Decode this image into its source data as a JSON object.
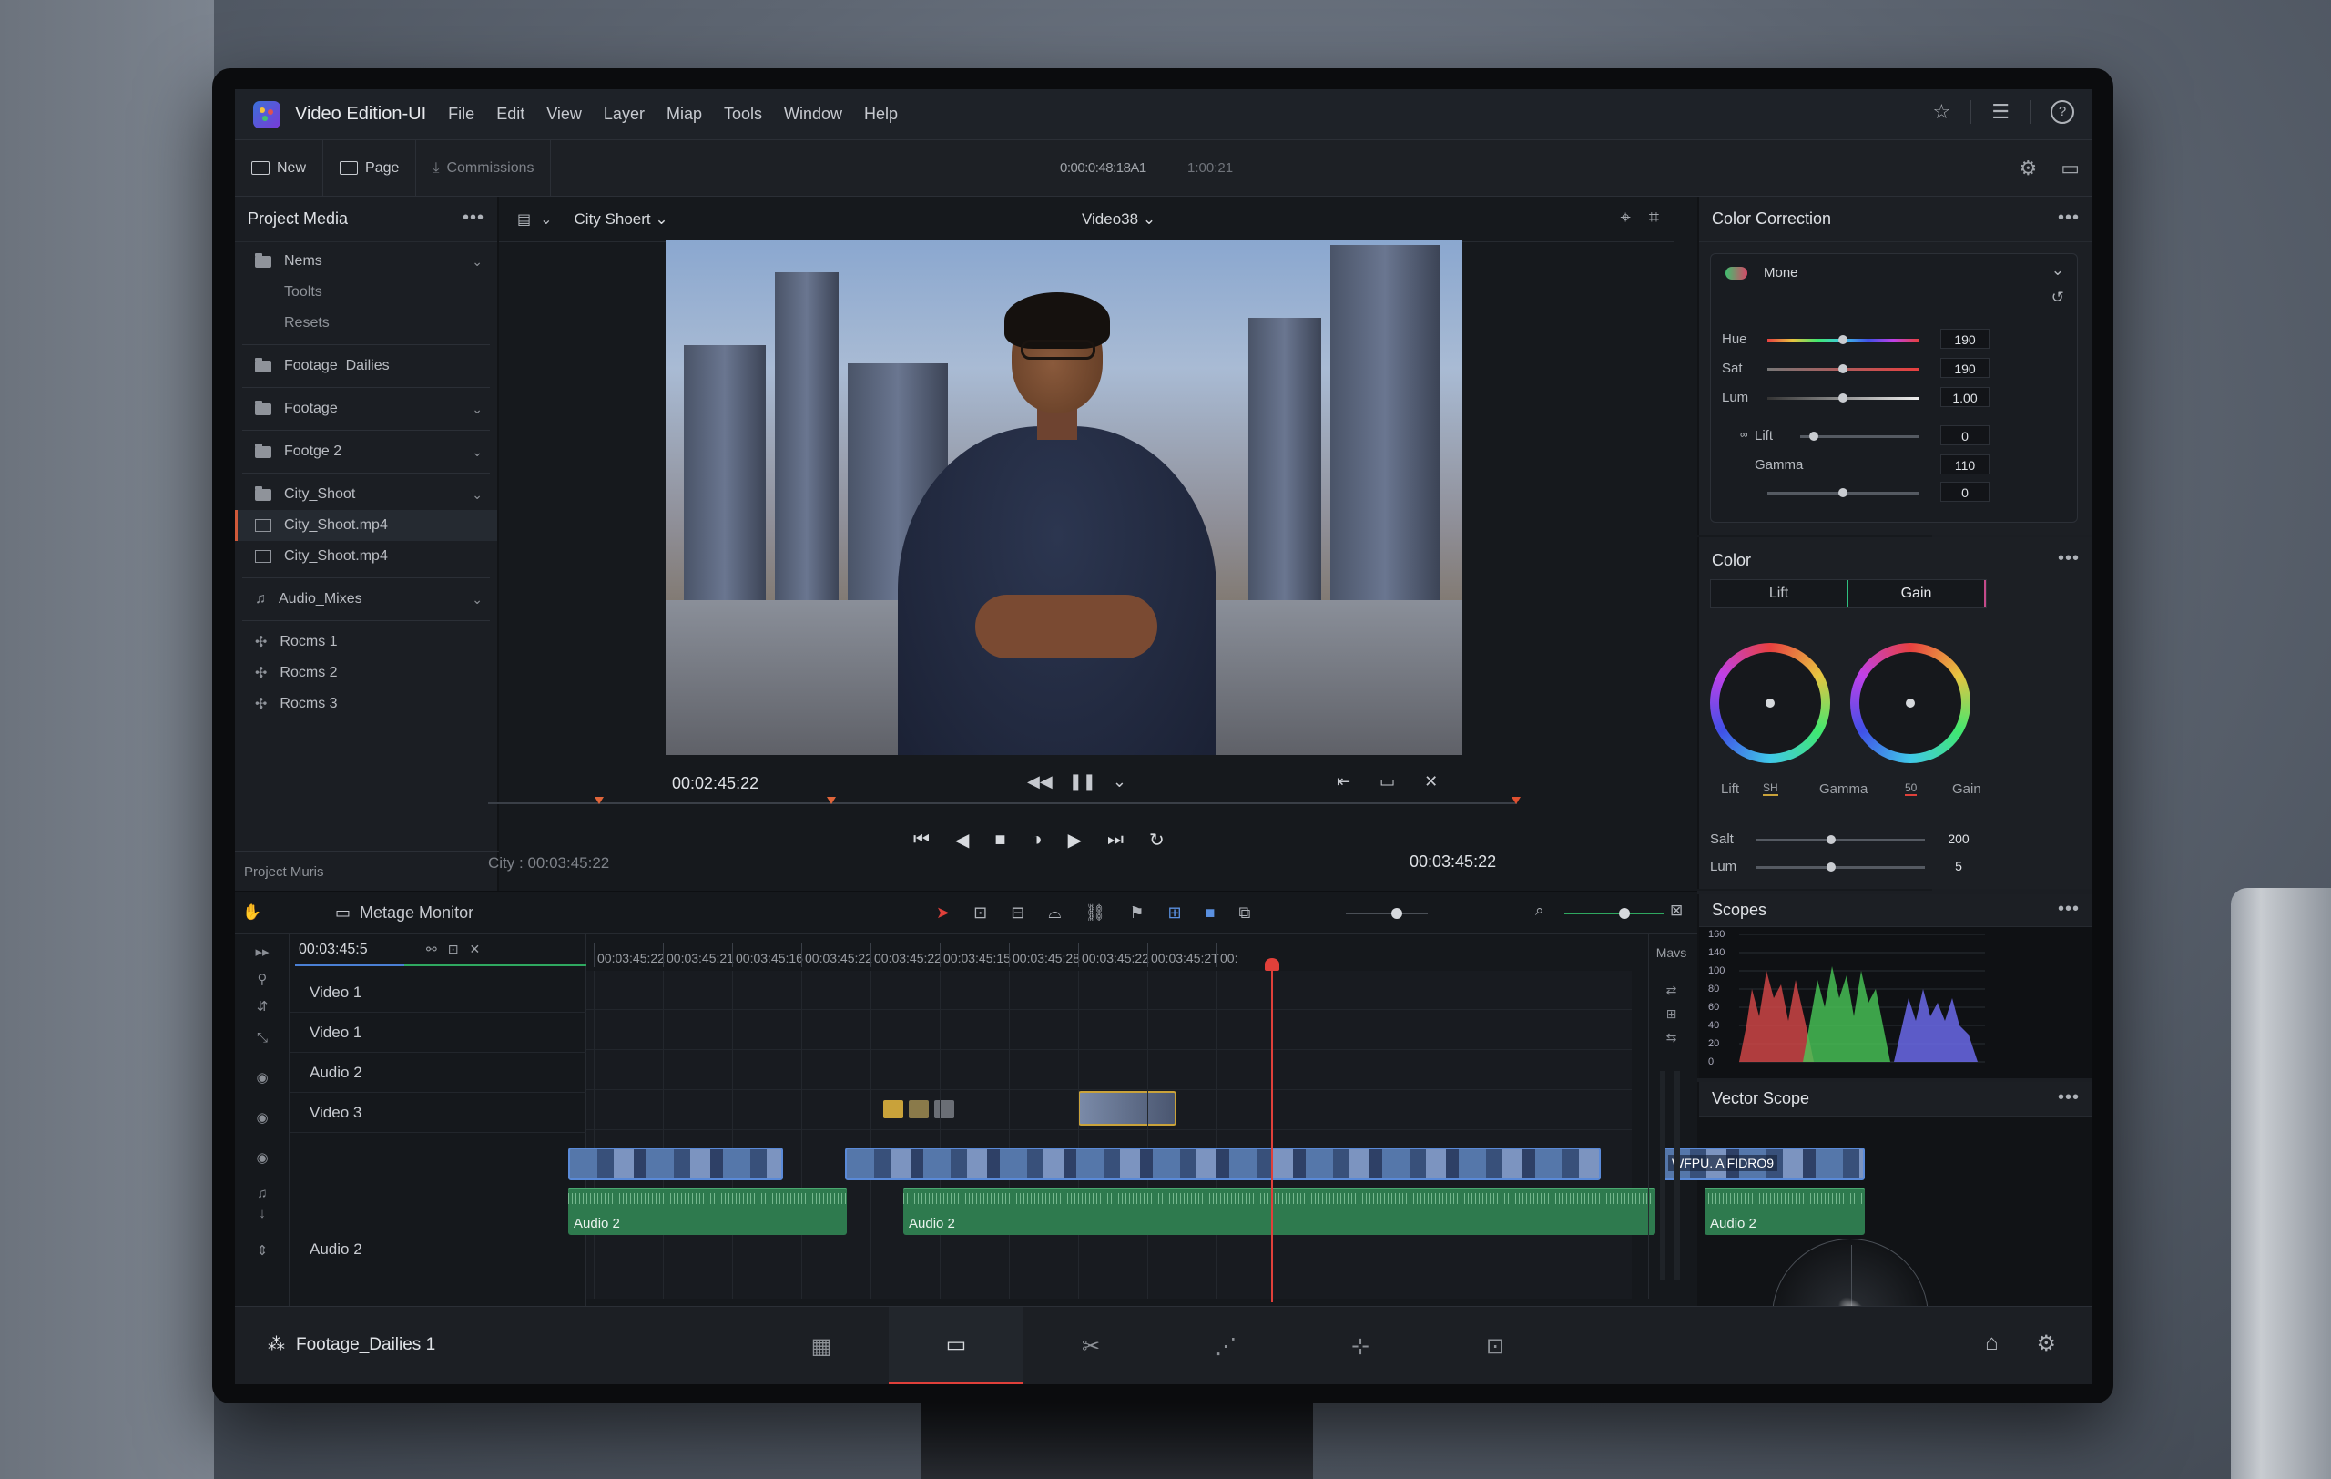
{
  "app": {
    "title": "Video Edition-UI",
    "menu": [
      "File",
      "Edit",
      "View",
      "Layer",
      "Miap",
      "Tools",
      "Window",
      "Help"
    ]
  },
  "toolbar": {
    "new_label": "New",
    "page_label": "Page",
    "commissions_label": "Commissions",
    "timecode": "0:00:0:48:18A1",
    "timecode2": "1:00:21"
  },
  "media": {
    "title": "Project Media",
    "items": [
      {
        "label": "Nems",
        "type": "folder"
      },
      {
        "label": "Toolts",
        "type": "sub"
      },
      {
        "label": "Resets",
        "type": "sub"
      },
      {
        "label": "Footage_Dailies",
        "type": "folder"
      },
      {
        "label": "Footage",
        "type": "folder"
      },
      {
        "label": "Footge 2",
        "type": "folder"
      },
      {
        "label": "City_Shoot",
        "type": "folder"
      },
      {
        "label": "City_Shoot.mp4",
        "type": "file",
        "selected": true
      },
      {
        "label": "City_Shoot.mp4",
        "type": "file"
      },
      {
        "label": "Audio_Mixes",
        "type": "audio"
      },
      {
        "label": "Rocms 1",
        "type": "misc"
      },
      {
        "label": "Rocms 2",
        "type": "misc"
      },
      {
        "label": "Rocms 3",
        "type": "misc"
      }
    ],
    "footer": "Project Muris"
  },
  "viewer": {
    "clip_name": "City Shoert",
    "video_select": "Video38",
    "current_time": "00:02:45:22",
    "city_tc": "City : 00:03:45:22",
    "end_tc": "00:03:45:22"
  },
  "color_correction": {
    "title": "Color Correction",
    "preset": "Mone",
    "hue_label": "Hue",
    "hue": "190",
    "sat_label": "Sat",
    "sat": "190",
    "lum_label": "Lum",
    "lum": "1.00",
    "lift_label": "Lift",
    "lift": "0",
    "gamma_label": "Gamma",
    "gamma": "110",
    "extra": "0"
  },
  "color": {
    "title": "Color",
    "tab_lift": "Lift",
    "tab_gain": "Gain",
    "wheel_labels": [
      "Lift",
      "SH",
      "Gamma",
      "50",
      "Gain"
    ],
    "salt_label": "Salt",
    "salt": "200",
    "lum_label": "Lum",
    "lum": "5"
  },
  "scopes": {
    "title": "Scopes",
    "scale": [
      "160",
      "140",
      "100",
      "80",
      "60",
      "40",
      "20",
      "0"
    ]
  },
  "vectorscope": {
    "title": "Vector Scope"
  },
  "timeline": {
    "monitor_label": "Metage Monitor",
    "timecode": "00:03:45:5",
    "ruler": [
      "00:03:45:22",
      "00:03:45:21",
      "00:03:45:16",
      "00:03:45:22",
      "00:03:45:22",
      "00:03:45:15",
      "00:03:45:28",
      "00:03:45:22",
      "00:03:45:2T",
      "00:"
    ],
    "tracks": [
      "Video 1",
      "Video 1",
      "Audio 2",
      "Video 3"
    ],
    "bottom_track": "Audio 2",
    "mavs": "Mavs",
    "clip_title": "WFPU. A FIDRO9",
    "audio_clips": [
      "Audio 2",
      "Audio 2",
      "Audio 2"
    ]
  },
  "bottom": {
    "project": "Footage_Dailies 1"
  }
}
